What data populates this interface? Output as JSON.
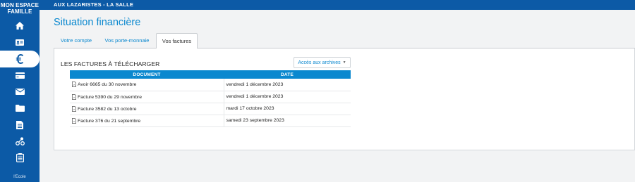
{
  "sidebar": {
    "brand_line1": "MON ESPACE",
    "brand_line2": "FAMILLE",
    "items": [
      {
        "name": "home",
        "icon": "home-icon"
      },
      {
        "name": "profile",
        "icon": "id-card-icon"
      },
      {
        "name": "finance",
        "icon": "euro-icon",
        "active": true
      },
      {
        "name": "payment",
        "icon": "credit-card-icon"
      },
      {
        "name": "messages",
        "icon": "envelope-icon"
      },
      {
        "name": "documents",
        "icon": "folder-icon"
      },
      {
        "name": "forms",
        "icon": "file-text-icon"
      },
      {
        "name": "network",
        "icon": "share-nodes-icon"
      },
      {
        "name": "checklist",
        "icon": "clipboard-list-icon"
      }
    ],
    "footer_label": "l'Ecole"
  },
  "topbar": {
    "school": "AUX LAZARISTES - LA SALLE"
  },
  "page": {
    "title": "Situation financière"
  },
  "tabs": [
    {
      "label": "Votre compte"
    },
    {
      "label": "Vos porte-monnaie"
    },
    {
      "label": "Vos factures",
      "active": true
    }
  ],
  "invoices": {
    "section_title": "LES FACTURES À TÉLÉCHARGER",
    "archive_button": "Accès aux archives",
    "columns": {
      "document": "DOCUMENT",
      "date": "DATE"
    },
    "rows": [
      {
        "document": "Avoir 6665 du 30 novembre",
        "date": "vendredi 1 décembre 2023"
      },
      {
        "document": "Facture 5390 du 29 novembre",
        "date": "vendredi 1 décembre 2023"
      },
      {
        "document": "Facture 3582 du 13 octobre",
        "date": "mardi 17 octobre 2023"
      },
      {
        "document": "Facture 376 du 21 septembre",
        "date": "samedi 23 septembre 2023"
      }
    ]
  },
  "colors": {
    "primary_blue": "#0c5aa6",
    "accent_blue": "#0a88cf",
    "background": "#f2f3f4"
  }
}
